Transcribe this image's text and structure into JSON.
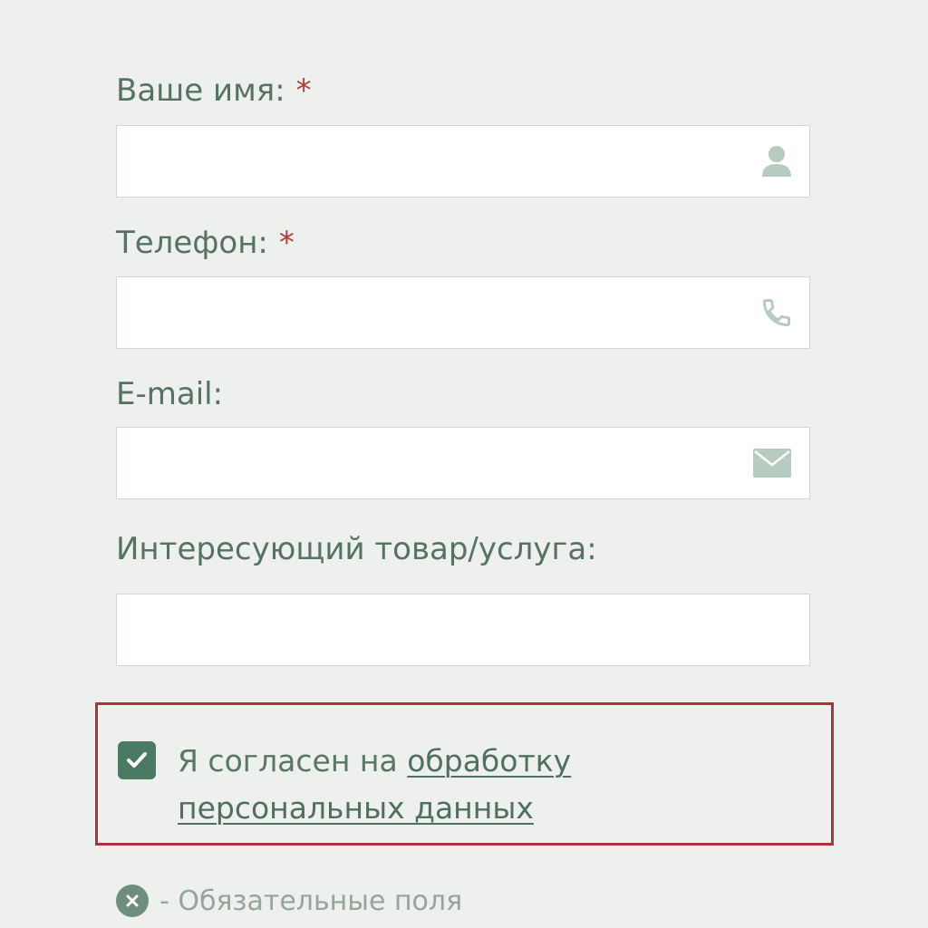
{
  "form": {
    "fields": [
      {
        "label": "Ваше имя:",
        "required_mark": "*",
        "value": "",
        "placeholder": "",
        "icon": "user-icon"
      },
      {
        "label": "Телефон:",
        "required_mark": "*",
        "value": "",
        "placeholder": "",
        "icon": "phone-icon"
      },
      {
        "label": "E-mail:",
        "value": "",
        "placeholder": "",
        "icon": "envelope-icon"
      },
      {
        "label": "Интересующий товар/услуга:",
        "value": "",
        "placeholder": ""
      }
    ],
    "consent": {
      "checked": true,
      "text_before": "Я согласен на ",
      "link_text": "обработку персональных данных"
    },
    "legend": {
      "icon": "close-circle-icon",
      "text": "- Обязательные поля"
    }
  },
  "colors": {
    "background": "#eef0ee",
    "label": "#557264",
    "required": "#b23a3a",
    "accent": "#4a7a61",
    "consent_border": "#a8353a",
    "icon": "#b7cbc0",
    "muted_text": "#95a59c"
  }
}
